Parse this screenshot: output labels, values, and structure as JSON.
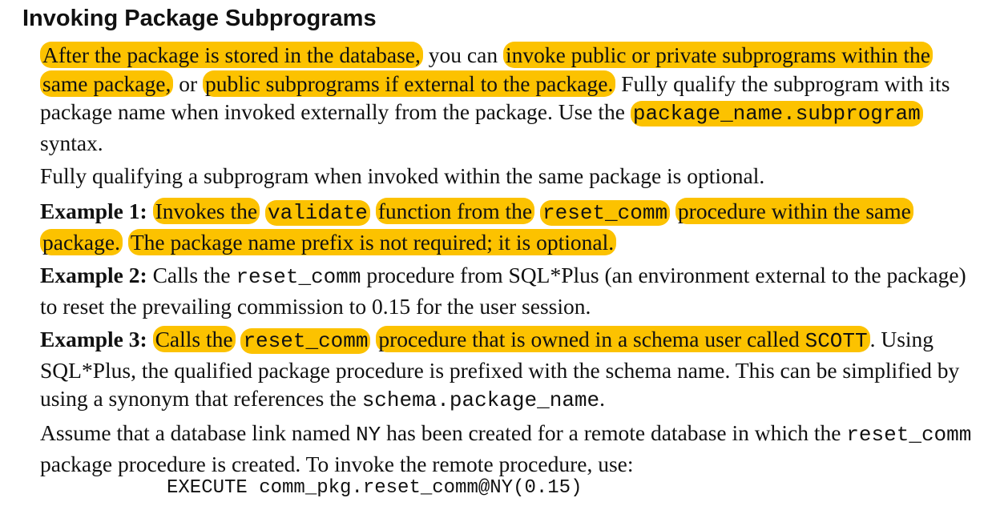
{
  "title": "Invoking Package Subprograms",
  "para1": {
    "s1": "After the package is stored in the database,",
    "s2": " you can ",
    "s3": "invoke public or private subprograms within the same package,",
    "s4": " or ",
    "s5": "public subprograms if external to the package.",
    "s6": " Fully qualify the subprogram with its package name when invoked externally from the package. Use the ",
    "code1": "package_name.subprogram",
    "s7": " syntax."
  },
  "para2": "Fully qualifying a subprogram when invoked within the same package is optional.",
  "example1": {
    "label": "Example 1:",
    "t1": "Invokes the",
    "code1": "validate",
    "t2": "function from the",
    "code2": "reset_comm",
    "t3": "procedure within the same package.",
    "t4": "The package name prefix is not required; it is optional."
  },
  "example2": {
    "label": "Example 2:",
    "t1": " Calls the ",
    "code1": "reset_comm",
    "t2": " procedure from SQL*Plus (an environment external to the package) to reset the prevailing commission to 0.15 for the user session."
  },
  "example3": {
    "label": "Example 3:",
    "t1": "Calls the",
    "code1": "reset_comm",
    "t2": "procedure that is owned in a schema user called ",
    "code2": "SCOTT",
    "t3": ". Using SQL*Plus, the qualified package procedure is prefixed with the schema name. This can be simplified by using a synonym that references the ",
    "code3": "schema.package_name",
    "t4": "."
  },
  "para6": {
    "t1": "Assume that a database link named ",
    "code1": "NY",
    "t2": " has been created for a remote database in which the ",
    "code2": "reset_comm",
    "t3": " package procedure is created. To invoke the remote procedure, use:"
  },
  "exec_line": "EXECUTE comm_pkg.reset_comm@NY(0.15)",
  "colors": {
    "highlight": "#fcc200",
    "text": "#111111"
  }
}
